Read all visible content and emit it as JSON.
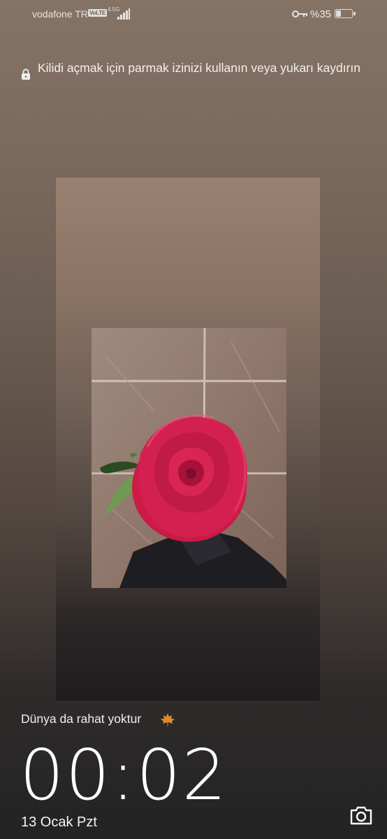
{
  "status": {
    "carrier": "vodafone TR",
    "volte": "VoLTE",
    "network": "4.5G",
    "battery_percent": "%35",
    "battery_level": 0.35,
    "icons": [
      "signal-icon",
      "key-icon",
      "battery-icon"
    ]
  },
  "lockscreen": {
    "unlock_hint": "Kilidi açmak için parmak izinizi kullanın veya yukarı kaydırın",
    "caption": "Dünya da rahat yoktur",
    "caption_emoji_icon": "maple-leaf-icon",
    "time": "00:02",
    "date": "13 Ocak Pzt"
  },
  "colors": {
    "rose": "#d8204e",
    "leaf": "#e08a2a"
  }
}
